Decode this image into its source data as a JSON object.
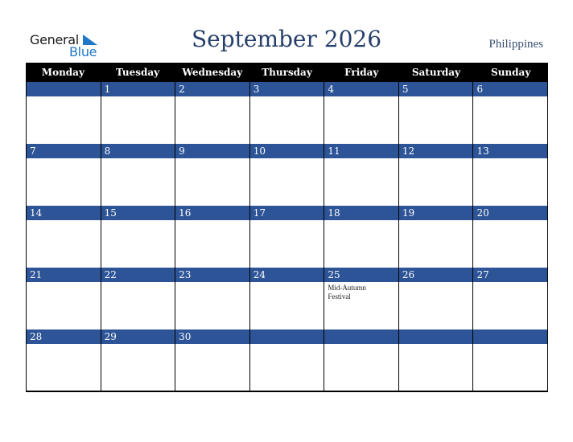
{
  "logo": {
    "line1": "General",
    "line2": "Blue"
  },
  "header": {
    "title": "September 2026",
    "country": "Philippines"
  },
  "colors": {
    "header_bg": "#000000",
    "day_bar": "#2d5496",
    "title": "#253f6a",
    "logo_blue": "#1f78c8"
  },
  "weekdays": [
    "Monday",
    "Tuesday",
    "Wednesday",
    "Thursday",
    "Friday",
    "Saturday",
    "Sunday"
  ],
  "weeks": [
    [
      {
        "day": "",
        "event": ""
      },
      {
        "day": "1",
        "event": ""
      },
      {
        "day": "2",
        "event": ""
      },
      {
        "day": "3",
        "event": ""
      },
      {
        "day": "4",
        "event": ""
      },
      {
        "day": "5",
        "event": ""
      },
      {
        "day": "6",
        "event": ""
      }
    ],
    [
      {
        "day": "7",
        "event": ""
      },
      {
        "day": "8",
        "event": ""
      },
      {
        "day": "9",
        "event": ""
      },
      {
        "day": "10",
        "event": ""
      },
      {
        "day": "11",
        "event": ""
      },
      {
        "day": "12",
        "event": ""
      },
      {
        "day": "13",
        "event": ""
      }
    ],
    [
      {
        "day": "14",
        "event": ""
      },
      {
        "day": "15",
        "event": ""
      },
      {
        "day": "16",
        "event": ""
      },
      {
        "day": "17",
        "event": ""
      },
      {
        "day": "18",
        "event": ""
      },
      {
        "day": "19",
        "event": ""
      },
      {
        "day": "20",
        "event": ""
      }
    ],
    [
      {
        "day": "21",
        "event": ""
      },
      {
        "day": "22",
        "event": ""
      },
      {
        "day": "23",
        "event": ""
      },
      {
        "day": "24",
        "event": ""
      },
      {
        "day": "25",
        "event": "Mid-Autumn Festival"
      },
      {
        "day": "26",
        "event": ""
      },
      {
        "day": "27",
        "event": ""
      }
    ],
    [
      {
        "day": "28",
        "event": ""
      },
      {
        "day": "29",
        "event": ""
      },
      {
        "day": "30",
        "event": ""
      },
      {
        "day": "",
        "event": ""
      },
      {
        "day": "",
        "event": ""
      },
      {
        "day": "",
        "event": ""
      },
      {
        "day": "",
        "event": ""
      }
    ]
  ]
}
